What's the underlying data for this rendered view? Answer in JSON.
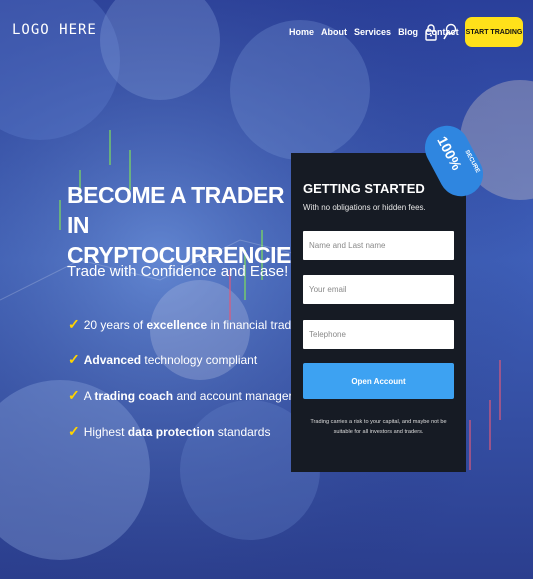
{
  "nav": {
    "logo": "LOGO HERE",
    "links": [
      "Home",
      "About",
      "Services",
      "Blog",
      "Contact"
    ],
    "cta": "START TRADING",
    "icons": [
      "lock-icon",
      "search-icon"
    ]
  },
  "hero": {
    "title_line1": "BECOME A TRADER IN",
    "title_line2": "CRYPTOCURRENCIES",
    "tagline": "Trade with Confidence and Ease!",
    "features": [
      {
        "pre": "20 years of ",
        "bold": "excellence",
        "post": " in financial trading"
      },
      {
        "pre": "",
        "bold": "Advanced",
        "post": " technology compliant"
      },
      {
        "pre": "A ",
        "bold": "trading coach",
        "post": " and account manager"
      },
      {
        "pre": "Highest ",
        "bold": "data protection",
        "post": " standards"
      }
    ],
    "tick": "✓"
  },
  "form": {
    "title": "GETTING STARTED",
    "subtitle": "With no obligations or hidden fees.",
    "name_placeholder": "Name and Last name",
    "email_placeholder": "Your email",
    "phone_placeholder": "Telephone",
    "submit": "Open Account",
    "disclaimer": "Trading carries a risk to your capital, and maybe not be suitable for all investors and traders."
  },
  "badge": {
    "percent": "100%",
    "label": "SECURE"
  },
  "colors": {
    "accent": "#ffe11a",
    "button": "#3da2f2",
    "card": "#161b24",
    "tick": "#ffd400"
  }
}
